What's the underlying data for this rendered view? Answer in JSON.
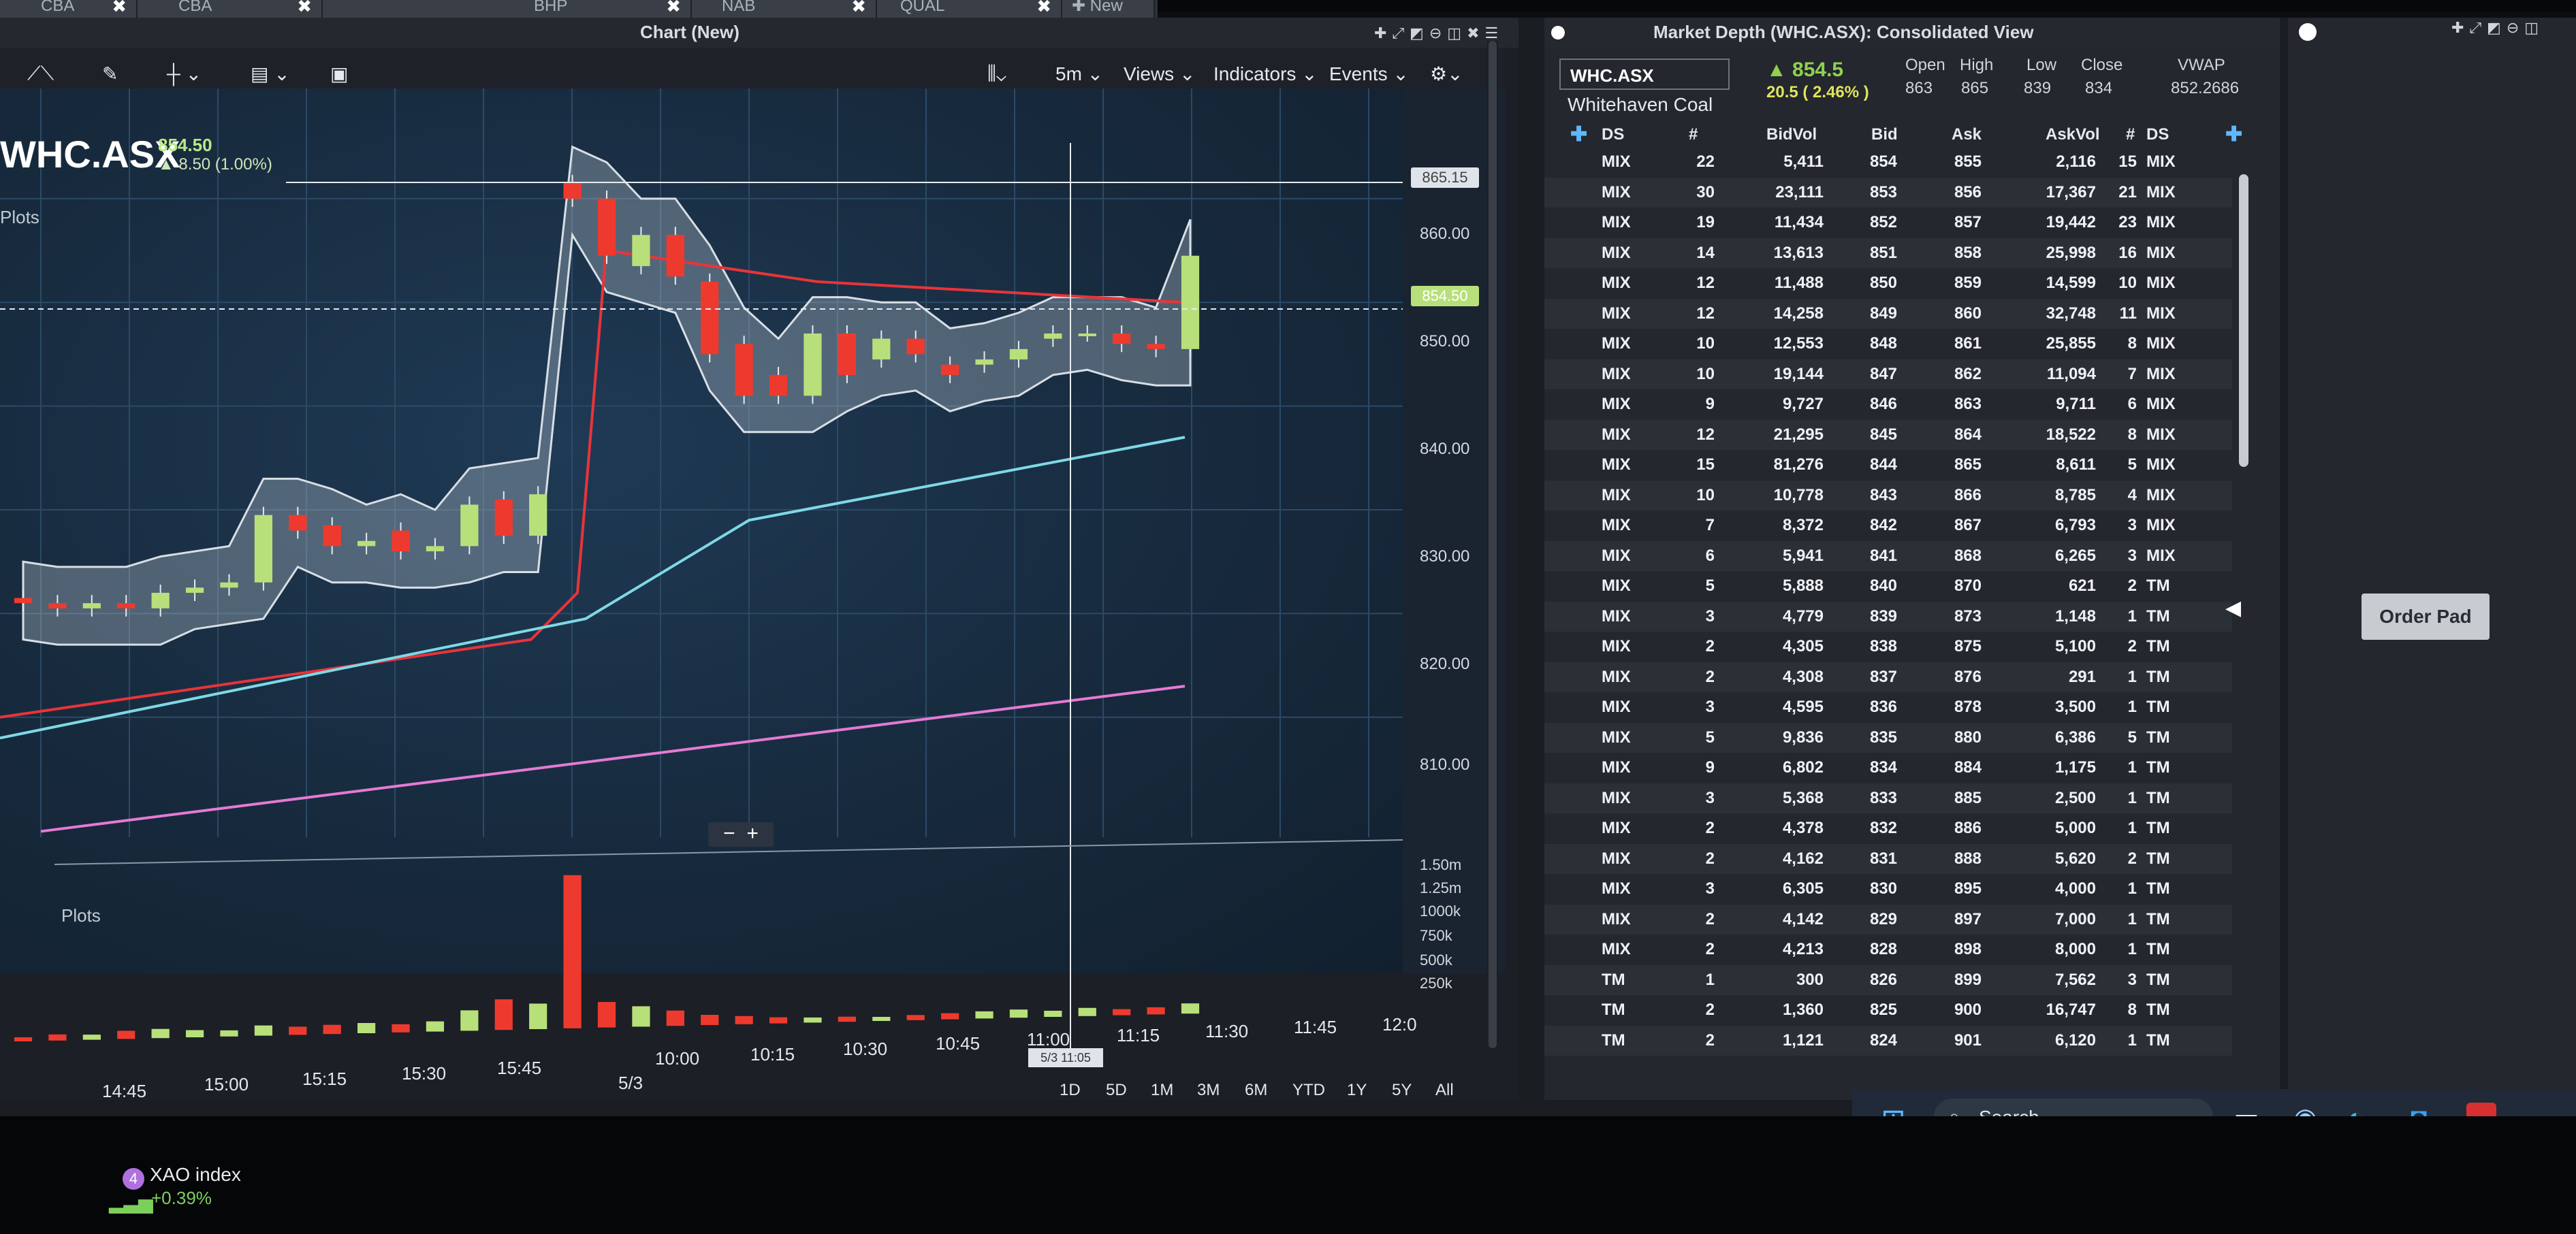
{
  "tabs": [
    {
      "label": "CBA"
    },
    {
      "label": "CBA"
    },
    {
      "label": "BHP"
    },
    {
      "label": "NAB"
    },
    {
      "label": "QUAL"
    },
    {
      "label": "New"
    }
  ],
  "chart_window": {
    "title": "Chart (New)",
    "toolbar": {
      "interval": "5m",
      "views": "Views",
      "indicators": "Indicators",
      "events": "Events"
    },
    "symbol": "WHC.ASX",
    "price": "854.50",
    "change": "8.50 (1.00%)",
    "plots_label": "Plots",
    "volume_plots_label": "Plots",
    "price_axis": [
      "860.00",
      "850.00",
      "840.00",
      "830.00",
      "820.00",
      "810.00"
    ],
    "price_tags": {
      "crosshair": "865.15",
      "last": "854.50"
    },
    "volume_axis": [
      "1.50m",
      "1.25m",
      "1000k",
      "750k",
      "500k",
      "250k"
    ],
    "time_axis": [
      "14:45",
      "15:00",
      "15:15",
      "15:30",
      "15:45",
      "10:00",
      "10:15",
      "10:30",
      "10:45",
      "11:00",
      "11:15",
      "11:30",
      "11:45",
      "12:0"
    ],
    "date_label": "5/3",
    "crosshair_time": "5/3 11:05",
    "ranges": [
      "1D",
      "5D",
      "1M",
      "3M",
      "6M",
      "YTD",
      "1Y",
      "5Y",
      "All"
    ],
    "zoom": {
      "minus": "−",
      "plus": "+"
    }
  },
  "chart_data": {
    "type": "candlestick",
    "title": "WHC.ASX",
    "ylim": [
      805,
      868
    ],
    "candles": [
      {
        "t": "14:45",
        "o": 821.5,
        "c": 821.0
      },
      {
        "t": "",
        "o": 821.0,
        "c": 820.5
      },
      {
        "t": "",
        "o": 820.5,
        "c": 821.0
      },
      {
        "t": "15:00",
        "o": 821.0,
        "c": 820.5
      },
      {
        "t": "",
        "o": 820.5,
        "c": 822.0
      },
      {
        "t": "",
        "o": 822.0,
        "c": 822.5
      },
      {
        "t": "15:15",
        "o": 822.5,
        "c": 823.0
      },
      {
        "t": "",
        "o": 823.0,
        "c": 829.5
      },
      {
        "t": "",
        "o": 829.5,
        "c": 828.0
      },
      {
        "t": "15:30",
        "o": 828.5,
        "c": 826.5
      },
      {
        "t": "",
        "o": 826.5,
        "c": 827.0
      },
      {
        "t": "",
        "o": 828.0,
        "c": 826.0
      },
      {
        "t": "15:45",
        "o": 826.0,
        "c": 826.5
      },
      {
        "t": "",
        "o": 826.5,
        "c": 830.5
      },
      {
        "t": "",
        "o": 831.0,
        "c": 827.5
      },
      {
        "t": "",
        "o": 827.5,
        "c": 831.5
      },
      {
        "t": "10:00",
        "o": 861.5,
        "c": 860.0
      },
      {
        "t": "",
        "o": 860.0,
        "c": 854.5
      },
      {
        "t": "",
        "o": 853.5,
        "c": 856.5
      },
      {
        "t": "10:15",
        "o": 856.5,
        "c": 852.5
      },
      {
        "t": "",
        "o": 852.0,
        "c": 845.0
      },
      {
        "t": "",
        "o": 846.0,
        "c": 841.0
      },
      {
        "t": "10:30",
        "o": 843.0,
        "c": 841.0
      },
      {
        "t": "",
        "o": 841.0,
        "c": 847.0
      },
      {
        "t": "",
        "o": 847.0,
        "c": 843.0
      },
      {
        "t": "10:45",
        "o": 844.5,
        "c": 846.5
      },
      {
        "t": "",
        "o": 846.5,
        "c": 845.0
      },
      {
        "t": "",
        "o": 844.0,
        "c": 843.0
      },
      {
        "t": "11:00",
        "o": 844.0,
        "c": 844.5
      },
      {
        "t": "",
        "o": 844.5,
        "c": 845.5
      },
      {
        "t": "",
        "o": 846.5,
        "c": 847.0
      },
      {
        "t": "11:15",
        "o": 847.0,
        "c": 847.0
      },
      {
        "t": "",
        "o": 847.0,
        "c": 846.0
      },
      {
        "t": "",
        "o": 846.0,
        "c": 845.5
      },
      {
        "t": "11:30",
        "o": 845.5,
        "c": 854.5
      }
    ],
    "volume": [
      40,
      60,
      50,
      80,
      90,
      70,
      60,
      100,
      80,
      90,
      100,
      80,
      100,
      200,
      300,
      250,
      1500,
      250,
      200,
      150,
      100,
      80,
      60,
      50,
      50,
      40,
      50,
      60,
      70,
      80,
      60,
      80,
      60,
      70,
      100
    ],
    "volume_ylim": [
      0,
      1600
    ]
  },
  "market_depth": {
    "title": "Market Depth (WHC.ASX): Consolidated View",
    "symbol": "WHC.ASX",
    "company": "Whitehaven Coal",
    "last": "854.5",
    "change": "20.5 ( 2.46% )",
    "stats": [
      {
        "label": "Open",
        "value": "863"
      },
      {
        "label": "High",
        "value": "865"
      },
      {
        "label": "Low",
        "value": "839"
      },
      {
        "label": "Close",
        "value": "834"
      },
      {
        "label": "VWAP",
        "value": "852.2686"
      }
    ],
    "columns": [
      "DS",
      "#",
      "BidVol",
      "Bid",
      "Ask",
      "AskVol",
      "#",
      "DS"
    ],
    "rows": [
      [
        "MIX",
        "22",
        "5,411",
        "854",
        "855",
        "2,116",
        "15",
        "MIX"
      ],
      [
        "MIX",
        "30",
        "23,111",
        "853",
        "856",
        "17,367",
        "21",
        "MIX"
      ],
      [
        "MIX",
        "19",
        "11,434",
        "852",
        "857",
        "19,442",
        "23",
        "MIX"
      ],
      [
        "MIX",
        "14",
        "13,613",
        "851",
        "858",
        "25,998",
        "16",
        "MIX"
      ],
      [
        "MIX",
        "12",
        "11,488",
        "850",
        "859",
        "14,599",
        "10",
        "MIX"
      ],
      [
        "MIX",
        "12",
        "14,258",
        "849",
        "860",
        "32,748",
        "11",
        "MIX"
      ],
      [
        "MIX",
        "10",
        "12,553",
        "848",
        "861",
        "25,855",
        "8",
        "MIX"
      ],
      [
        "MIX",
        "10",
        "19,144",
        "847",
        "862",
        "11,094",
        "7",
        "MIX"
      ],
      [
        "MIX",
        "9",
        "9,727",
        "846",
        "863",
        "9,711",
        "6",
        "MIX"
      ],
      [
        "MIX",
        "12",
        "21,295",
        "845",
        "864",
        "18,522",
        "8",
        "MIX"
      ],
      [
        "MIX",
        "15",
        "81,276",
        "844",
        "865",
        "8,611",
        "5",
        "MIX"
      ],
      [
        "MIX",
        "10",
        "10,778",
        "843",
        "866",
        "8,785",
        "4",
        "MIX"
      ],
      [
        "MIX",
        "7",
        "8,372",
        "842",
        "867",
        "6,793",
        "3",
        "MIX"
      ],
      [
        "MIX",
        "6",
        "5,941",
        "841",
        "868",
        "6,265",
        "3",
        "MIX"
      ],
      [
        "MIX",
        "5",
        "5,888",
        "840",
        "870",
        "621",
        "2",
        "TM"
      ],
      [
        "MIX",
        "3",
        "4,779",
        "839",
        "873",
        "1,148",
        "1",
        "TM"
      ],
      [
        "MIX",
        "2",
        "4,305",
        "838",
        "875",
        "5,100",
        "2",
        "TM"
      ],
      [
        "MIX",
        "2",
        "4,308",
        "837",
        "876",
        "291",
        "1",
        "TM"
      ],
      [
        "MIX",
        "3",
        "4,595",
        "836",
        "878",
        "3,500",
        "1",
        "TM"
      ],
      [
        "MIX",
        "5",
        "9,836",
        "835",
        "880",
        "6,386",
        "5",
        "TM"
      ],
      [
        "MIX",
        "9",
        "6,802",
        "834",
        "884",
        "1,175",
        "1",
        "TM"
      ],
      [
        "MIX",
        "3",
        "5,368",
        "833",
        "885",
        "2,500",
        "1",
        "TM"
      ],
      [
        "MIX",
        "2",
        "4,378",
        "832",
        "886",
        "5,000",
        "1",
        "TM"
      ],
      [
        "MIX",
        "2",
        "4,162",
        "831",
        "888",
        "5,620",
        "2",
        "TM"
      ],
      [
        "MIX",
        "3",
        "6,305",
        "830",
        "895",
        "4,000",
        "1",
        "TM"
      ],
      [
        "MIX",
        "2",
        "4,142",
        "829",
        "897",
        "7,000",
        "1",
        "TM"
      ],
      [
        "MIX",
        "2",
        "4,213",
        "828",
        "898",
        "8,000",
        "1",
        "TM"
      ],
      [
        "TM",
        "1",
        "300",
        "826",
        "899",
        "7,562",
        "3",
        "TM"
      ],
      [
        "TM",
        "2",
        "1,360",
        "825",
        "900",
        "16,747",
        "8",
        "TM"
      ],
      [
        "TM",
        "2",
        "1,121",
        "824",
        "901",
        "6,120",
        "1",
        "TM"
      ]
    ]
  },
  "side_panel": {
    "order_pad": "Order Pad"
  },
  "taskbar": {
    "search": "Search"
  },
  "widget": {
    "badge": "4",
    "name": "XAO index",
    "change": "+0.39%"
  },
  "colors": {
    "up": "#b7e07a",
    "down": "#ee3a2e",
    "band": "#c9cfd6",
    "sma_red": "#e8343a",
    "sma_cyan": "#7fd8e6",
    "sma_pink": "#e57ad4"
  }
}
